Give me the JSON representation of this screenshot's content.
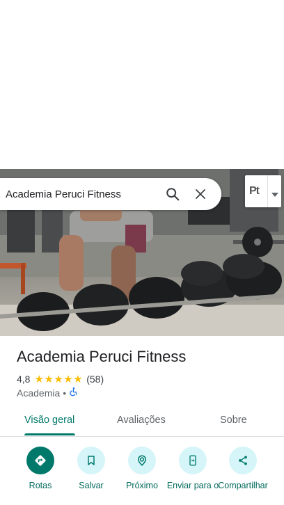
{
  "search": {
    "query": "Academia Peruci Fitness"
  },
  "map_layer": {
    "label": "Pt"
  },
  "place": {
    "name": "Academia Peruci Fitness",
    "rating": "4,8",
    "stars": "★★★★★",
    "review_count": "(58)",
    "category": "Academia",
    "separator": "•"
  },
  "tabs": [
    {
      "label": "Visão geral",
      "active": true
    },
    {
      "label": "Avaliações",
      "active": false
    },
    {
      "label": "Sobre",
      "active": false
    }
  ],
  "actions": [
    {
      "label": "Rotas",
      "icon": "directions-icon"
    },
    {
      "label": "Salvar",
      "icon": "bookmark-icon"
    },
    {
      "label": "Próximo",
      "icon": "nearby-icon"
    },
    {
      "label": "Enviar para o",
      "icon": "send-to-phone-icon"
    },
    {
      "label": "Compartilhar",
      "icon": "share-icon"
    }
  ],
  "colors": {
    "accent": "#00796b",
    "action_bg": "#d5f5f9",
    "star": "#fbbc04"
  }
}
